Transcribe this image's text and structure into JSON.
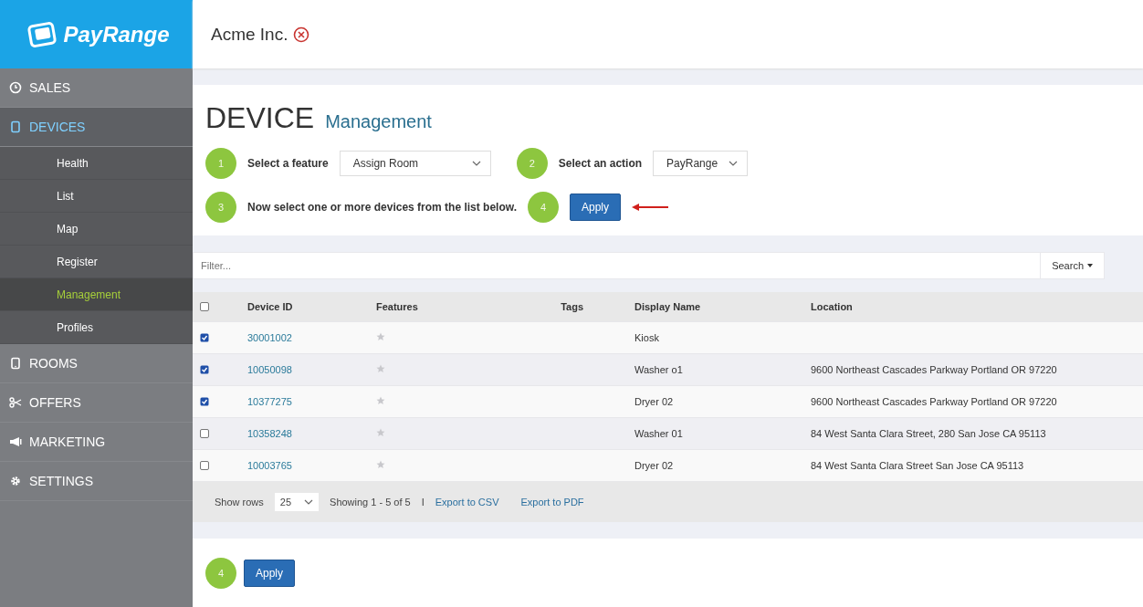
{
  "logo": {
    "text": "PayRange"
  },
  "sidebar": {
    "items": [
      {
        "label": "SALES",
        "selected": false
      },
      {
        "label": "DEVICES",
        "selected": true,
        "children": [
          {
            "label": "Health",
            "selected": false
          },
          {
            "label": "List",
            "selected": false
          },
          {
            "label": "Map",
            "selected": false
          },
          {
            "label": "Register",
            "selected": false
          },
          {
            "label": "Management",
            "selected": true
          },
          {
            "label": "Profiles",
            "selected": false
          }
        ]
      },
      {
        "label": "ROOMS",
        "selected": false
      },
      {
        "label": "OFFERS",
        "selected": false
      },
      {
        "label": "MARKETING",
        "selected": false
      },
      {
        "label": "SETTINGS",
        "selected": false
      }
    ]
  },
  "header": {
    "account": "Acme Inc."
  },
  "page": {
    "title": "DEVICE",
    "subtitle": "Management"
  },
  "steps": {
    "feature": {
      "number": "1",
      "label": "Select a feature",
      "value": "Assign Room"
    },
    "action": {
      "number": "2",
      "label": "Select an action",
      "value": "PayRange"
    },
    "select": {
      "number": "3",
      "label": "Now select one or more devices from the list below."
    },
    "apply": {
      "number": "4",
      "button": "Apply"
    }
  },
  "filter": {
    "placeholder": "Filter...",
    "button": "Search"
  },
  "table": {
    "columns": [
      "Device ID",
      "Features",
      "Tags",
      "Display Name",
      "Location"
    ],
    "header_checked": false,
    "rows": [
      {
        "checked": true,
        "device_id": "30001002",
        "display_name": "Kiosk"
      },
      {
        "checked": true,
        "device_id": "10050098",
        "display_name": "Washer o1",
        "location": "9600 Northeast Cascades Parkway Portland OR 97220"
      },
      {
        "checked": true,
        "device_id": "10377275",
        "display_name": "Dryer 02",
        "location": "9600 Northeast Cascades Parkway Portland OR 97220"
      },
      {
        "checked": false,
        "device_id": "10358248",
        "display_name": "Washer 01",
        "location": "84 West Santa Clara Street, 280 San Jose CA 95113"
      },
      {
        "checked": false,
        "device_id": "10003765",
        "display_name": "Dryer 02",
        "location": "84 West Santa Clara Street San Jose CA 95113"
      }
    ]
  },
  "footer": {
    "show_rows_label": "Show rows",
    "rows_value": "25",
    "showing": "Showing 1 - 5 of 5",
    "separator": "I",
    "export_csv": "Export to CSV",
    "export_pdf": "Export to PDF"
  },
  "bottom": {
    "number": "4",
    "button": "Apply"
  }
}
